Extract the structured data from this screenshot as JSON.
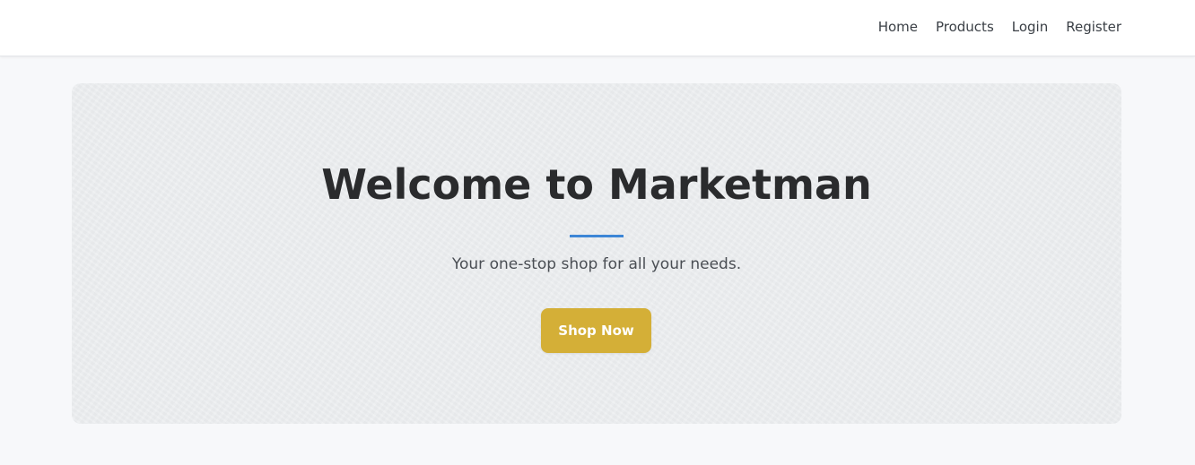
{
  "nav": {
    "items": [
      {
        "label": "Home"
      },
      {
        "label": "Products"
      },
      {
        "label": "Login"
      },
      {
        "label": "Register"
      }
    ]
  },
  "hero": {
    "title": "Welcome to Marketman",
    "subtitle": "Your one-stop shop for all your needs.",
    "cta_label": "Shop Now"
  },
  "colors": {
    "accent_divider": "#3d86d6",
    "cta_background": "#d4af37",
    "page_background": "#f7f8fa",
    "hero_background": "#eceef0"
  }
}
